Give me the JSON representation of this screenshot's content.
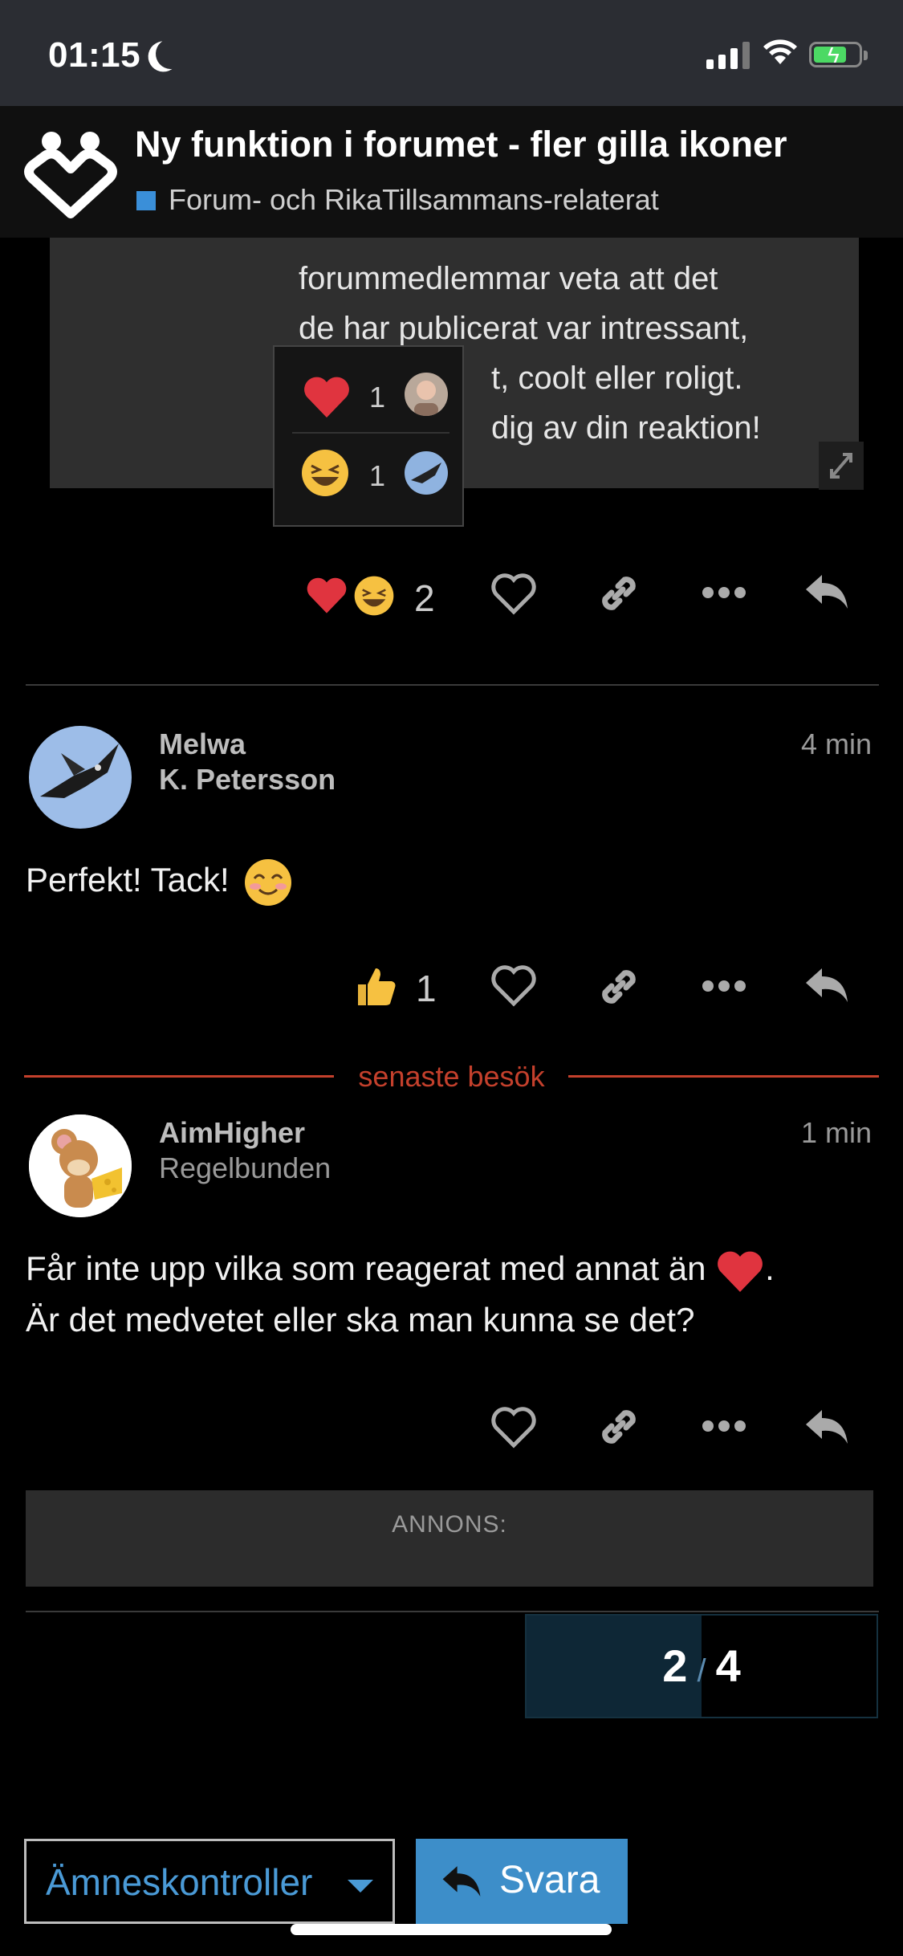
{
  "status_bar": {
    "time": "01:15"
  },
  "header": {
    "title": "Ny funktion i forumet - fler gilla ikoner",
    "category": "Forum- och RikaTillsammans-relaterat",
    "category_color": "#3a8fd9"
  },
  "embedded_image": {
    "lines": [
      "forummedlemmar veta att det",
      "de har publicerat var intressant,",
      "t, coolt eller roligt.",
      "dig av din reaktion!"
    ]
  },
  "reaction_popup": {
    "rows": [
      {
        "emoji": "heart",
        "count": "1"
      },
      {
        "emoji": "laughing",
        "count": "1"
      }
    ]
  },
  "post1_actions": {
    "reaction_count": "2"
  },
  "post2": {
    "username": "Melwa",
    "user_title": "K. Petersson",
    "time": "4 min",
    "text": "Perfekt! Tack!",
    "reaction_count": "1"
  },
  "last_visit_label": "senaste besök",
  "post3": {
    "username": "AimHigher",
    "user_title": "Regelbunden",
    "time": "1 min",
    "line1": "Får inte upp vilka som reagerat med annat än",
    "line1_end": ".",
    "line2": "Är det medvetet eller ska man kunna se det?"
  },
  "ad_label": "ANNONS:",
  "progress": {
    "current": "2",
    "total": "4",
    "fraction": 0.5
  },
  "footer": {
    "controls_label": "Ämneskontroller",
    "reply_label": "Svara"
  },
  "colors": {
    "accent": "#3d8ec9",
    "last_visit": "#c4402c",
    "heart": "#e0343f"
  }
}
